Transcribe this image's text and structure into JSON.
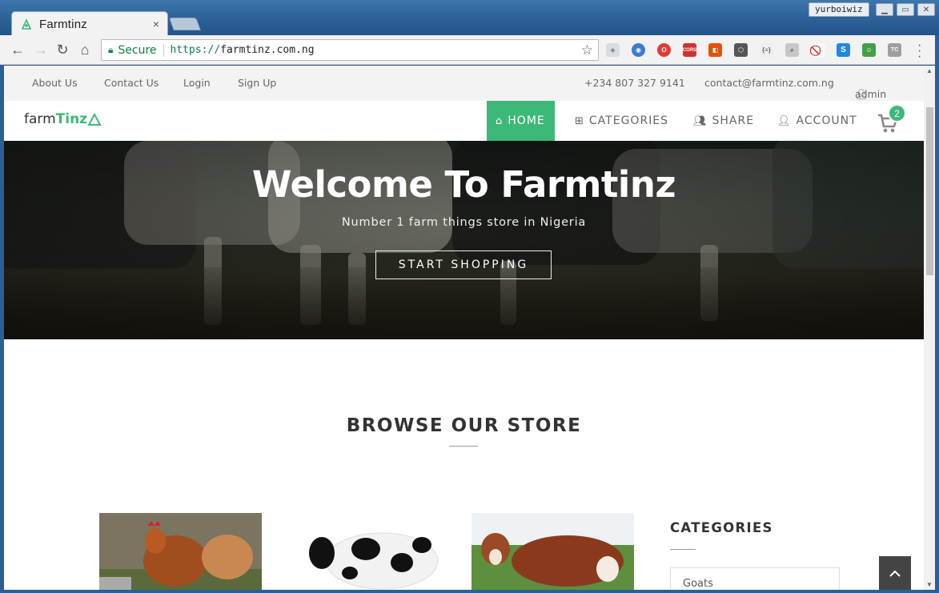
{
  "browser": {
    "tab_title": "Farmtinz",
    "tab_close": "×",
    "profile_name": "yurboiwiz",
    "secure_label": "Secure",
    "url_scheme": "https://",
    "url_host": "farmtinz.com.ng",
    "extensions": [
      "shield-ext",
      "globe-ext",
      "opera-ext",
      "cors-ext",
      "office-ext",
      "cube-ext",
      "json-ext",
      "search-ext",
      "block-ext",
      "s-ext",
      "android-ext",
      "tc-ext"
    ],
    "cors_label": "CORS",
    "tc_label": "TC",
    "json_label": "{≡}",
    "s_label": "S"
  },
  "topbar": {
    "about": "About Us",
    "contact": "Contact Us",
    "login": "Login",
    "signup": "Sign Up",
    "phone": "+234 807 327 9141",
    "email": "contact@farmtinz.com.ng",
    "user": "admin"
  },
  "logo": {
    "part1": "farm",
    "part2": "Tinz"
  },
  "nav": {
    "home": "HOME",
    "categories": "CATEGORIES",
    "share": "SHARE",
    "account": "ACCOUNT",
    "cart_count": "2"
  },
  "hero": {
    "title": "Welcome To Farmtinz",
    "subtitle": "Number 1 farm things store in Nigeria",
    "cta": "START SHOPPING"
  },
  "store": {
    "title": "BROWSE OUR STORE"
  },
  "sidebar": {
    "title": "CATEGORIES",
    "first_item": "Goats"
  },
  "colors": {
    "accent": "#3cb878",
    "chrome_blue": "#2b5f95"
  }
}
